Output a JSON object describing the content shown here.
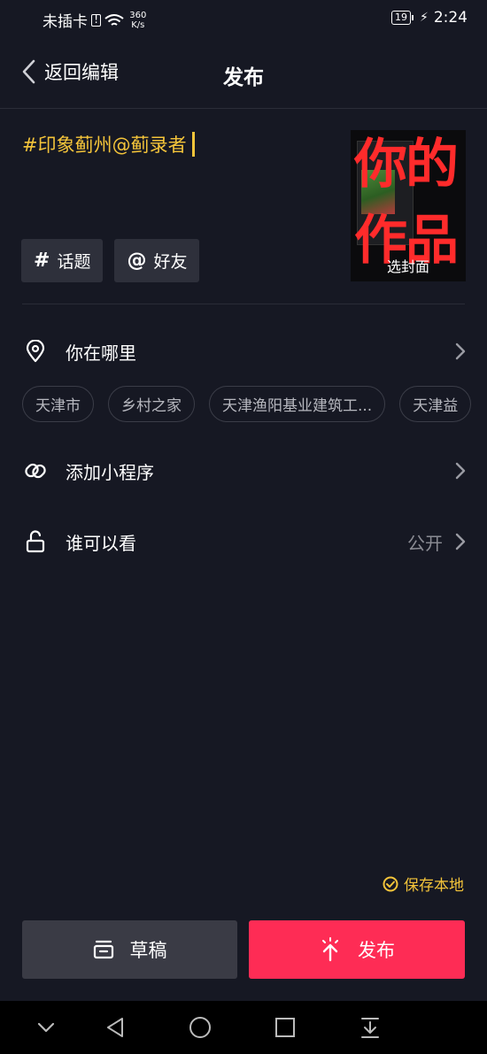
{
  "status_bar": {
    "carrier": "未插卡",
    "speed_value": "360",
    "speed_unit": "K/s",
    "battery": "19",
    "time": "2:24"
  },
  "header": {
    "back_label": "返回编辑",
    "title": "发布"
  },
  "caption": {
    "text": "#印象蓟州@蓟录者"
  },
  "chips": [
    {
      "symbol": "#",
      "label": "话题",
      "icon": "hashtag-icon"
    },
    {
      "symbol": "@",
      "label": "好友",
      "icon": "at-icon"
    }
  ],
  "cover": {
    "overlay_text_line1": "你的",
    "overlay_text_line2": "作品",
    "label": "选封面"
  },
  "location": {
    "label": "你在哪里",
    "icon": "location-pin-icon",
    "tags": [
      "天津市",
      "乡村之家",
      "天津渔阳基业建筑工...",
      "天津益"
    ]
  },
  "mini_program": {
    "label": "添加小程序",
    "icon": "link-icon"
  },
  "visibility": {
    "label": "谁可以看",
    "value": "公开",
    "icon": "unlock-icon"
  },
  "save_local": {
    "label": "保存本地",
    "icon": "check-circle-icon"
  },
  "actions": {
    "draft_label": "草稿",
    "draft_icon": "draft-box-icon",
    "publish_label": "发布",
    "publish_icon": "upload-arrow-icon"
  },
  "colors": {
    "background": "#161823",
    "accent_yellow": "#f4c43a",
    "publish_red": "#fe2c55"
  }
}
